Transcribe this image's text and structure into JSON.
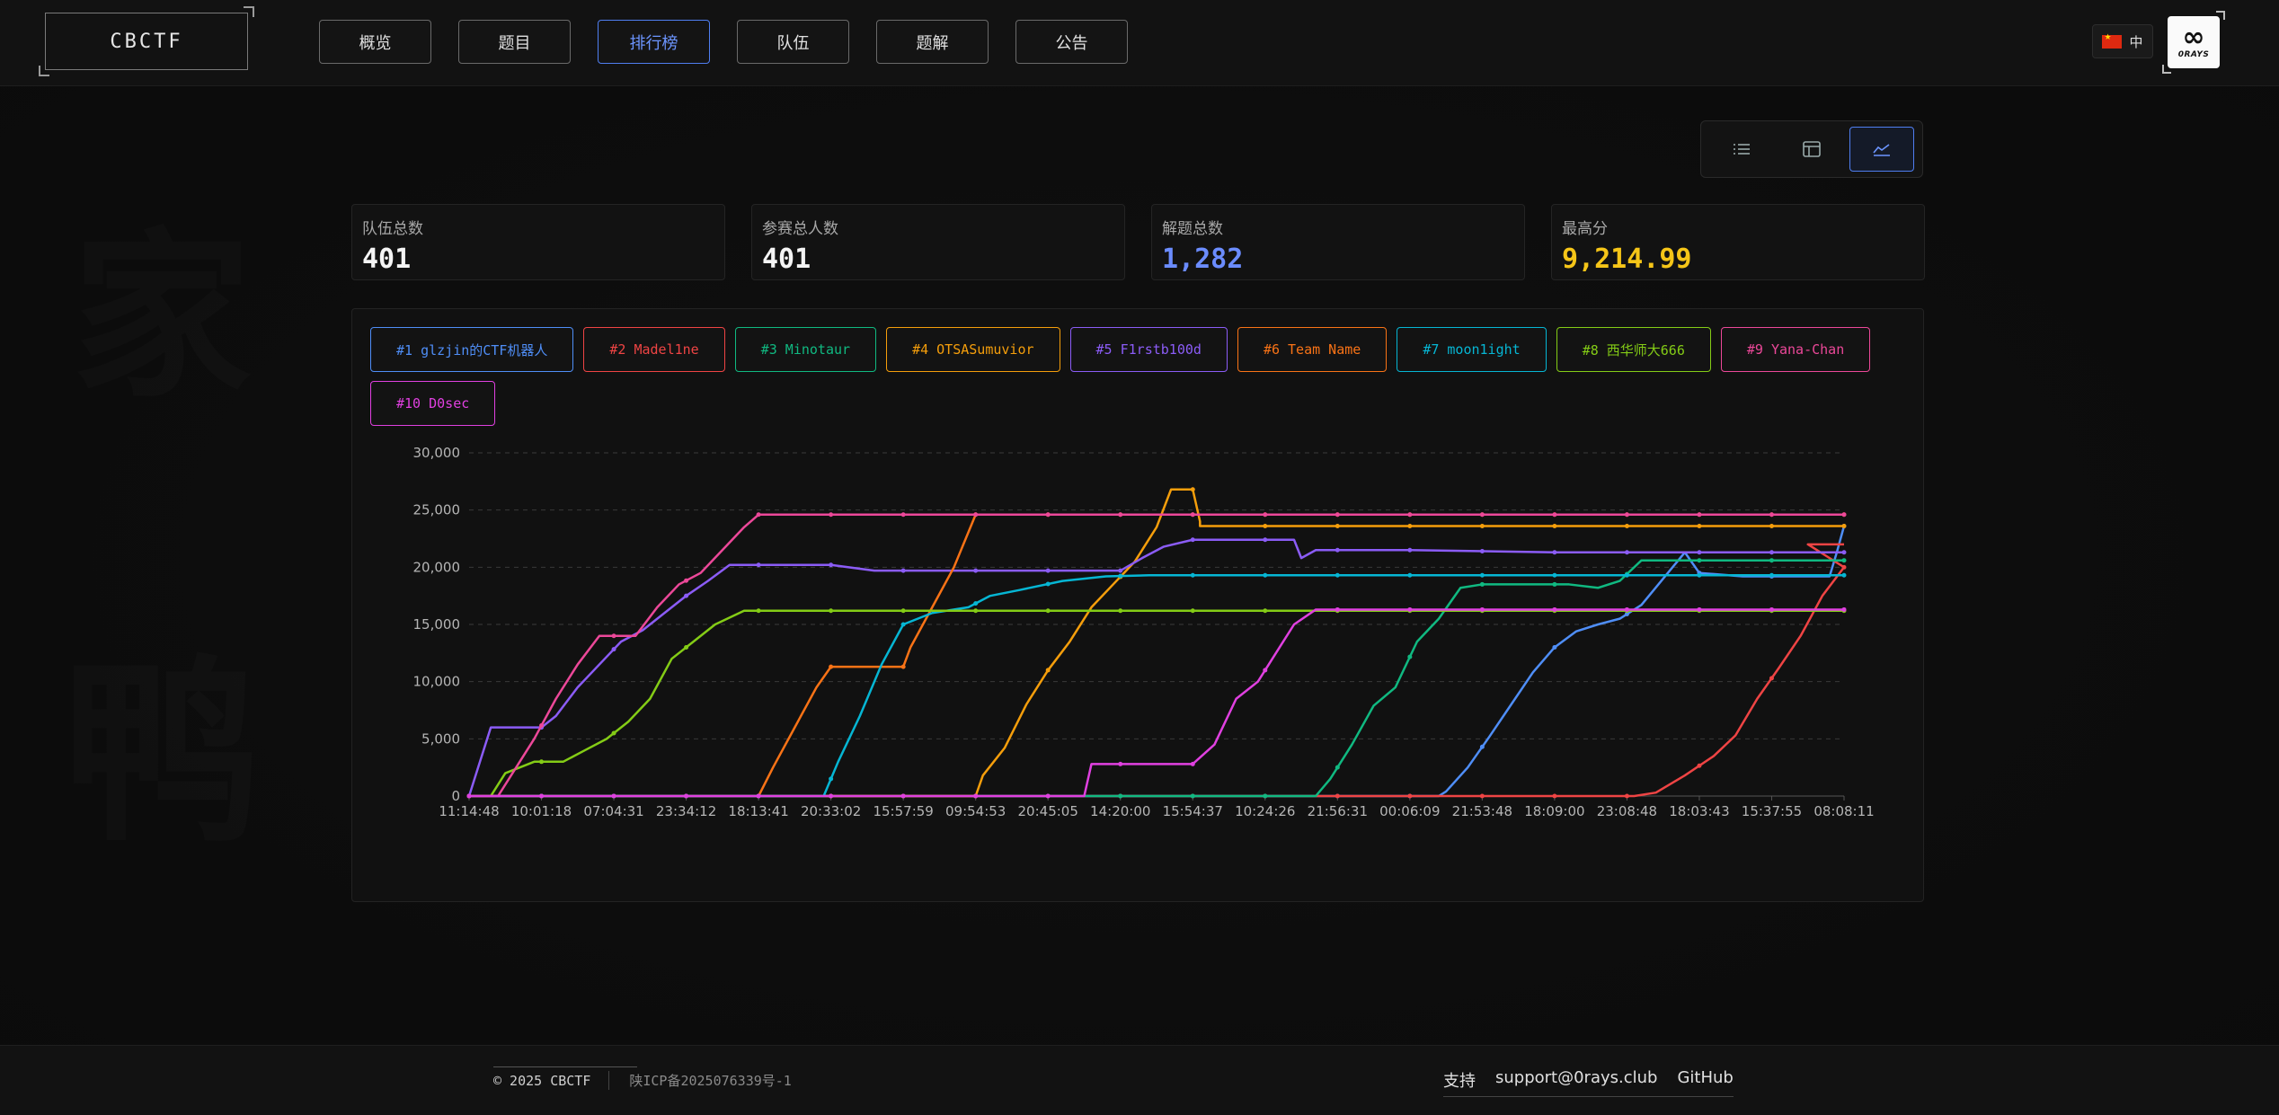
{
  "header": {
    "logo": "CBCTF",
    "nav": [
      {
        "label": "概览",
        "active": false
      },
      {
        "label": "题目",
        "active": false
      },
      {
        "label": "排行榜",
        "active": true
      },
      {
        "label": "队伍",
        "active": false
      },
      {
        "label": "题解",
        "active": false
      },
      {
        "label": "公告",
        "active": false
      }
    ],
    "language": "中",
    "team_logo_text": "0RAYS"
  },
  "view_toggle": {
    "options": [
      "list-icon",
      "table-icon",
      "chart-icon"
    ],
    "active": "chart-icon"
  },
  "stats": [
    {
      "label": "队伍总数",
      "value": "401",
      "color": "#f4f4f4"
    },
    {
      "label": "参赛总人数",
      "value": "401",
      "color": "#f4f4f4"
    },
    {
      "label": "解题总数",
      "value": "1,282",
      "color": "#6b8cff"
    },
    {
      "label": "最高分",
      "value": "9,214.99",
      "color": "#f5c518"
    }
  ],
  "chart_data": {
    "type": "line",
    "ylim": [
      0,
      30000
    ],
    "yticks": [
      "0",
      "5,000",
      "10,000",
      "15,000",
      "20,000",
      "25,000",
      "30,000"
    ],
    "x_labels": [
      "11:14:48",
      "10:01:18",
      "07:04:31",
      "23:34:12",
      "18:13:41",
      "20:33:02",
      "15:57:59",
      "09:54:53",
      "20:45:05",
      "14:20:00",
      "15:54:37",
      "10:24:26",
      "21:56:31",
      "00:06:09",
      "21:53:48",
      "18:09:00",
      "23:08:48",
      "18:03:43",
      "15:37:55",
      "08:08:11"
    ],
    "series": [
      {
        "name": "#1 glzjin的CTF机器人",
        "color": "#4f8ef7",
        "points": [
          [
            0,
            0
          ],
          [
            13.4,
            0
          ],
          [
            13.5,
            400
          ],
          [
            13.8,
            2500
          ],
          [
            14.1,
            5200
          ],
          [
            14.4,
            8000
          ],
          [
            14.7,
            10800
          ],
          [
            15.0,
            13000
          ],
          [
            15.3,
            14400
          ],
          [
            15.6,
            15000
          ],
          [
            15.9,
            15500
          ],
          [
            16.2,
            16700
          ],
          [
            16.5,
            19000
          ],
          [
            16.8,
            21300
          ],
          [
            17.0,
            19500
          ],
          [
            17.6,
            19200
          ],
          [
            18.2,
            19200
          ],
          [
            18.8,
            19200
          ],
          [
            18.9,
            21300
          ],
          [
            19.0,
            23600
          ]
        ]
      },
      {
        "name": "#2 Madel1ne",
        "color": "#ef4444",
        "points": [
          [
            0,
            0
          ],
          [
            16.1,
            0
          ],
          [
            16.4,
            300
          ],
          [
            16.8,
            1800
          ],
          [
            17.2,
            3500
          ],
          [
            17.5,
            5300
          ],
          [
            17.8,
            8500
          ],
          [
            18.1,
            11200
          ],
          [
            18.4,
            14000
          ],
          [
            18.7,
            17500
          ],
          [
            19.0,
            20000
          ],
          [
            18.5,
            22000
          ],
          [
            19.0,
            22000
          ]
        ]
      },
      {
        "name": "#3 Minotaur",
        "color": "#10b981",
        "points": [
          [
            0,
            0
          ],
          [
            11.7,
            0
          ],
          [
            11.9,
            1500
          ],
          [
            12.2,
            4500
          ],
          [
            12.5,
            7900
          ],
          [
            12.8,
            9500
          ],
          [
            13.1,
            13500
          ],
          [
            13.4,
            15500
          ],
          [
            13.7,
            18200
          ],
          [
            14.0,
            18500
          ],
          [
            14.6,
            18500
          ],
          [
            15.2,
            18500
          ],
          [
            15.6,
            18200
          ],
          [
            15.9,
            18800
          ],
          [
            16.2,
            20600
          ],
          [
            17.0,
            20600
          ],
          [
            18.0,
            20600
          ],
          [
            19.0,
            20600
          ]
        ]
      },
      {
        "name": "#4 OTSASumuvior",
        "color": "#f59e0b",
        "points": [
          [
            0,
            0
          ],
          [
            7.0,
            0
          ],
          [
            7.1,
            1800
          ],
          [
            7.4,
            4200
          ],
          [
            7.7,
            8000
          ],
          [
            8.0,
            11000
          ],
          [
            8.3,
            13500
          ],
          [
            8.6,
            16500
          ],
          [
            8.9,
            18500
          ],
          [
            9.2,
            20500
          ],
          [
            9.5,
            23500
          ],
          [
            9.7,
            26800
          ],
          [
            10.0,
            26800
          ],
          [
            10.1,
            24000
          ],
          [
            10.1,
            23600
          ],
          [
            11.0,
            23600
          ],
          [
            13.0,
            23600
          ],
          [
            15.0,
            23600
          ],
          [
            17.0,
            23600
          ],
          [
            19.0,
            23600
          ]
        ]
      },
      {
        "name": "#5 F1rstb100d",
        "color": "#8b5cf6",
        "points": [
          [
            0,
            0
          ],
          [
            0.1,
            2000
          ],
          [
            0.3,
            6000
          ],
          [
            1.0,
            6000
          ],
          [
            1.2,
            7000
          ],
          [
            1.5,
            9500
          ],
          [
            1.8,
            11500
          ],
          [
            2.1,
            13500
          ],
          [
            2.4,
            14500
          ],
          [
            2.7,
            16000
          ],
          [
            3.0,
            17500
          ],
          [
            3.3,
            18800
          ],
          [
            3.6,
            20200
          ],
          [
            5.0,
            20200
          ],
          [
            5.6,
            19700
          ],
          [
            7.0,
            19700
          ],
          [
            8.0,
            19700
          ],
          [
            9.0,
            19700
          ],
          [
            9.3,
            20800
          ],
          [
            9.6,
            21800
          ],
          [
            10.0,
            22400
          ],
          [
            11.0,
            22400
          ],
          [
            11.4,
            22400
          ],
          [
            11.5,
            20800
          ],
          [
            11.7,
            21500
          ],
          [
            13.0,
            21500
          ],
          [
            15.0,
            21300
          ],
          [
            17.0,
            21300
          ],
          [
            19.0,
            21300
          ]
        ]
      },
      {
        "name": "#6 Team Name",
        "color": "#f97316",
        "points": [
          [
            0,
            0
          ],
          [
            4.0,
            0
          ],
          [
            4.2,
            2500
          ],
          [
            4.5,
            6000
          ],
          [
            4.8,
            9500
          ],
          [
            5.0,
            11300
          ],
          [
            6.0,
            11300
          ],
          [
            6.1,
            13000
          ],
          [
            6.4,
            16500
          ],
          [
            6.7,
            20000
          ],
          [
            7.0,
            24600
          ],
          [
            9.0,
            24600
          ],
          [
            12.0,
            24600
          ],
          [
            15.0,
            24600
          ],
          [
            19.0,
            24600
          ]
        ]
      },
      {
        "name": "#7 moon1ight",
        "color": "#06b6d4",
        "points": [
          [
            0,
            0
          ],
          [
            4.9,
            0
          ],
          [
            5.1,
            3000
          ],
          [
            5.4,
            7000
          ],
          [
            5.7,
            11500
          ],
          [
            6.0,
            15000
          ],
          [
            6.4,
            16000
          ],
          [
            6.9,
            16500
          ],
          [
            7.2,
            17500
          ],
          [
            7.6,
            18000
          ],
          [
            8.2,
            18800
          ],
          [
            8.8,
            19200
          ],
          [
            9.4,
            19300
          ],
          [
            10.5,
            19300
          ],
          [
            12.0,
            19300
          ],
          [
            14.0,
            19300
          ],
          [
            16.0,
            19300
          ],
          [
            18.0,
            19300
          ],
          [
            19.0,
            19300
          ]
        ]
      },
      {
        "name": "#8 西华师大666",
        "color": "#84cc16",
        "points": [
          [
            0,
            0
          ],
          [
            0.3,
            0
          ],
          [
            0.5,
            2000
          ],
          [
            0.9,
            3000
          ],
          [
            1.3,
            3000
          ],
          [
            1.6,
            4000
          ],
          [
            1.9,
            5000
          ],
          [
            2.2,
            6500
          ],
          [
            2.5,
            8500
          ],
          [
            2.8,
            12000
          ],
          [
            3.1,
            13500
          ],
          [
            3.4,
            15000
          ],
          [
            3.8,
            16200
          ],
          [
            5.0,
            16200
          ],
          [
            7.0,
            16200
          ],
          [
            9.0,
            16200
          ],
          [
            11.0,
            16200
          ],
          [
            13.0,
            16200
          ],
          [
            15.0,
            16200
          ],
          [
            17.0,
            16200
          ],
          [
            19.0,
            16200
          ]
        ]
      },
      {
        "name": "#9 Yana-Chan",
        "color": "#ec4899",
        "points": [
          [
            0,
            0
          ],
          [
            0.4,
            0
          ],
          [
            0.6,
            2000
          ],
          [
            0.9,
            5000
          ],
          [
            1.2,
            8500
          ],
          [
            1.5,
            11500
          ],
          [
            1.8,
            14000
          ],
          [
            2.3,
            14000
          ],
          [
            2.6,
            16500
          ],
          [
            2.9,
            18500
          ],
          [
            3.2,
            19500
          ],
          [
            3.5,
            21500
          ],
          [
            3.8,
            23500
          ],
          [
            4.0,
            24600
          ],
          [
            6.0,
            24600
          ],
          [
            8.0,
            24600
          ],
          [
            10.0,
            24600
          ],
          [
            12.0,
            24600
          ],
          [
            14.0,
            24600
          ],
          [
            16.0,
            24600
          ],
          [
            18.0,
            24600
          ],
          [
            19.0,
            24600
          ]
        ]
      },
      {
        "name": "#10 D0sec",
        "color": "#e040e0",
        "points": [
          [
            0,
            0
          ],
          [
            8.5,
            0
          ],
          [
            8.6,
            2800
          ],
          [
            10.0,
            2800
          ],
          [
            10.3,
            4500
          ],
          [
            10.6,
            8500
          ],
          [
            10.9,
            10000
          ],
          [
            11.2,
            13000
          ],
          [
            11.4,
            15000
          ],
          [
            11.7,
            16300
          ],
          [
            13.0,
            16300
          ],
          [
            15.0,
            16300
          ],
          [
            17.0,
            16300
          ],
          [
            19.0,
            16300
          ]
        ]
      }
    ]
  },
  "footer": {
    "copyright": "© 2025 CBCTF",
    "icp": "陕ICP备2025076339号-1",
    "links": [
      "支持",
      "support@0rays.club",
      "GitHub"
    ]
  }
}
